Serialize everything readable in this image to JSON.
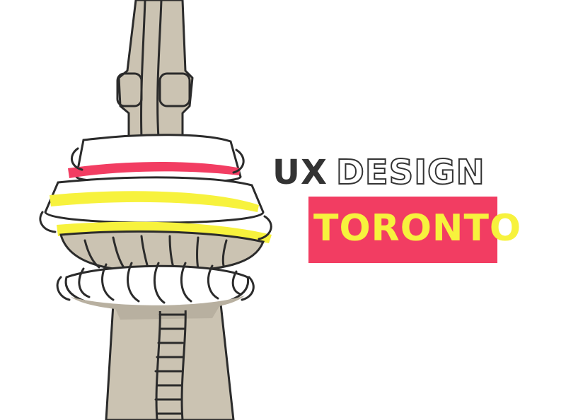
{
  "heading": {
    "solid_word": "UX",
    "outline_word": "DESIGN",
    "city": "TORONTO"
  },
  "colors": {
    "text_dark": "#333333",
    "accent_pink": "#f23d62",
    "accent_yellow": "#f7f23d",
    "tower_fill": "#cbc3b2",
    "tower_shadow": "#b8b0a0",
    "background": "#ffffff"
  },
  "illustration": {
    "subject": "cn-tower-line-drawing"
  }
}
